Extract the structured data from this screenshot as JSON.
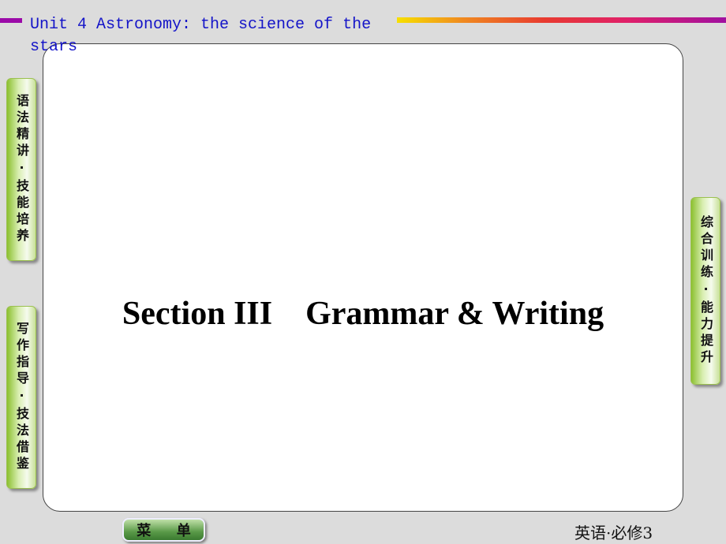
{
  "header": {
    "title": "Unit 4  Astronomy: the science of the stars"
  },
  "main": {
    "heading": "Section III    Grammar & Writing"
  },
  "sidebar_left": [
    {
      "label": "语法精讲·技能培养"
    },
    {
      "label": "写作指导·技法借鉴"
    }
  ],
  "sidebar_right": [
    {
      "label": "综合训练·能力提升"
    }
  ],
  "footer": {
    "menu_chars": [
      "菜",
      "单"
    ],
    "book": "英语·必修3"
  }
}
